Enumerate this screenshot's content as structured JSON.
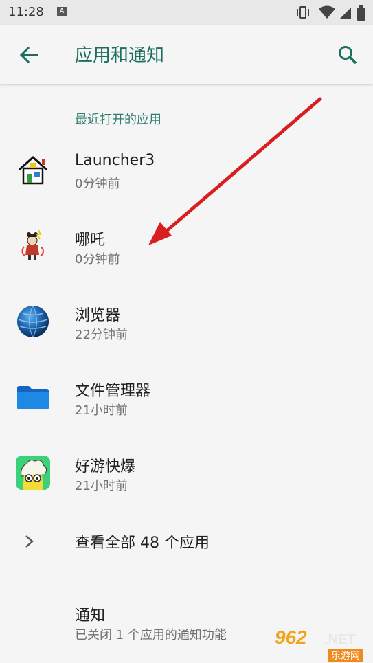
{
  "status_bar": {
    "time": "11:28",
    "badge": "A",
    "icons": [
      "vibrate-icon",
      "wifi-icon",
      "signal-icon",
      "battery-icon"
    ]
  },
  "app_bar": {
    "back_icon": "arrow-back-icon",
    "title": "应用和通知",
    "search_icon": "search-icon"
  },
  "recent": {
    "header": "最近打开的应用",
    "apps": [
      {
        "name": "Launcher3",
        "time": "0分钟前",
        "icon": "house-icon"
      },
      {
        "name": "哪吒",
        "time": "0分钟前",
        "icon": "nezha-character-icon"
      },
      {
        "name": "浏览器",
        "time": "22分钟前",
        "icon": "globe-icon"
      },
      {
        "name": "文件管理器",
        "time": "21小时前",
        "icon": "folder-icon"
      },
      {
        "name": "好游快爆",
        "time": "21小时前",
        "icon": "haoyou-kuaibao-icon"
      }
    ],
    "see_all": "查看全部 48 个应用"
  },
  "notifications": {
    "title": "通知",
    "summary": "已关闭 1 个应用的通知功能"
  },
  "watermark": {
    "brand": "962",
    "net": ".NET",
    "site": "乐游网"
  },
  "colors": {
    "accent": "#1b6f5f",
    "annotation_arrow": "#d81e1e",
    "background": "#f5f5f5"
  }
}
